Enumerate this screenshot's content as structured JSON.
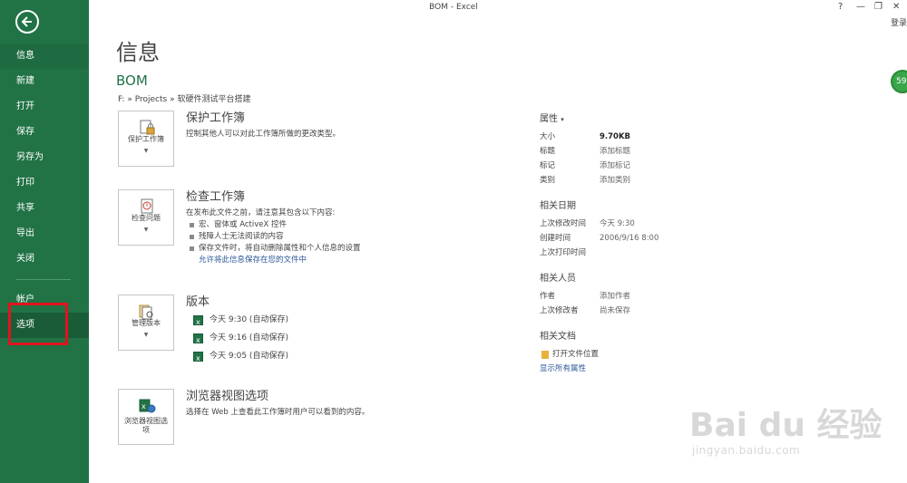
{
  "window": {
    "title": "BOM - Excel",
    "help": "?",
    "minimize": "—",
    "restore": "❐",
    "close": "✕",
    "login": "登录",
    "badge": "59"
  },
  "sidebar": {
    "items": [
      {
        "label": "信息"
      },
      {
        "label": "新建"
      },
      {
        "label": "打开"
      },
      {
        "label": "保存"
      },
      {
        "label": "另存为"
      },
      {
        "label": "打印"
      },
      {
        "label": "共享"
      },
      {
        "label": "导出"
      },
      {
        "label": "关闭"
      }
    ],
    "bottom_items": [
      {
        "label": "帐户"
      },
      {
        "label": "选项"
      }
    ]
  },
  "main": {
    "title": "信息",
    "doc_name": "BOM",
    "breadcrumb": "F: » Projects » 软硬件测试平台搭建",
    "protect": {
      "button_label": "保护工作簿",
      "title": "保护工作簿",
      "desc": "控制其他人可以对此工作簿所做的更改类型。"
    },
    "inspect": {
      "button_label": "检查问题",
      "title": "检查工作簿",
      "desc": "在发布此文件之前，请注意其包含以下内容:",
      "bullets": [
        "宏、窗体或 ActiveX 控件",
        "残障人士无法阅读的内容",
        "保存文件时，将自动删除属性和个人信息的设置"
      ],
      "link": "允许将此信息保存在您的文件中"
    },
    "versions": {
      "button_label": "管理版本",
      "title": "版本",
      "items": [
        "今天 9:30 (自动保存)",
        "今天 9:16 (自动保存)",
        "今天 9:05 (自动保存)"
      ]
    },
    "browser": {
      "button_label": "浏览器视图选项",
      "title": "浏览器视图选项",
      "desc": "选择在 Web 上查看此工作簿时用户可以看到的内容。"
    }
  },
  "props": {
    "header": "属性",
    "rows": [
      {
        "k": "大小",
        "v": "9.70KB"
      },
      {
        "k": "标题",
        "v": "添加标题"
      },
      {
        "k": "标记",
        "v": "添加标记"
      },
      {
        "k": "类别",
        "v": "添加类别"
      }
    ],
    "dates_header": "相关日期",
    "dates": [
      {
        "k": "上次修改时间",
        "v": "今天 9:30"
      },
      {
        "k": "创建时间",
        "v": "2006/9/16 8:00"
      },
      {
        "k": "上次打印时间",
        "v": ""
      }
    ],
    "people_header": "相关人员",
    "people": [
      {
        "k": "作者",
        "v": "添加作者"
      },
      {
        "k": "上次修改者",
        "v": "尚未保存"
      }
    ],
    "docs_header": "相关文档",
    "open_location": "打开文件位置",
    "show_all": "显示所有属性"
  },
  "watermark": {
    "text": "Bai du 经验",
    "sub": "jingyan.baidu.com"
  }
}
